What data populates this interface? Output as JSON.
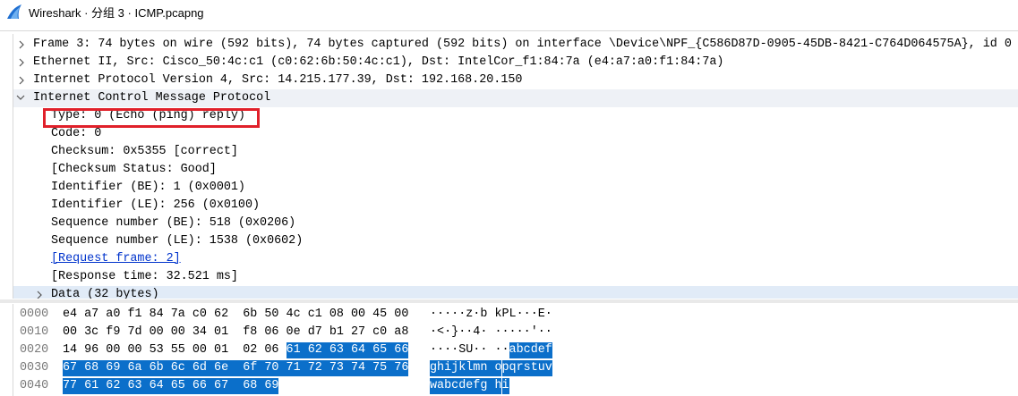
{
  "window": {
    "title": "Wireshark · 分组 3 · ICMP.pcapng"
  },
  "tree": {
    "frame": "Frame 3: 74 bytes on wire (592 bits), 74 bytes captured (592 bits) on interface \\Device\\NPF_{C586D87D-0905-45DB-8421-C764D064575A}, id 0",
    "ethernet": "Ethernet II, Src: Cisco_50:4c:c1 (c0:62:6b:50:4c:c1), Dst: IntelCor_f1:84:7a (e4:a7:a0:f1:84:7a)",
    "ip": "Internet Protocol Version 4, Src: 14.215.177.39, Dst: 192.168.20.150",
    "icmp": "Internet Control Message Protocol",
    "icmp_fields": {
      "type": "Type: 0 (Echo (ping) reply)",
      "code": "Code: 0",
      "checksum": "Checksum: 0x5355 [correct]",
      "checksum_status": "[Checksum Status: Good]",
      "id_be": "Identifier (BE): 1 (0x0001)",
      "id_le": "Identifier (LE): 256 (0x0100)",
      "seq_be": "Sequence number (BE): 518 (0x0206)",
      "seq_le": "Sequence number (LE): 1538 (0x0602)",
      "request_frame": "[Request frame: 2]",
      "response_time": "[Response time: 32.521 ms]",
      "data": "Data (32 bytes)"
    }
  },
  "hex": {
    "rows": [
      {
        "offset": "0000",
        "bytes": [
          "e4",
          "a7",
          "a0",
          "f1",
          "84",
          "7a",
          "c0",
          "62",
          "6b",
          "50",
          "4c",
          "c1",
          "08",
          "00",
          "45",
          "00"
        ],
        "selected_from": 16,
        "ascii": [
          "·",
          "·",
          "·",
          "·",
          "·",
          "z",
          "·",
          "b",
          "k",
          "P",
          "L",
          "·",
          "·",
          "·",
          "E",
          "·"
        ]
      },
      {
        "offset": "0010",
        "bytes": [
          "00",
          "3c",
          "f9",
          "7d",
          "00",
          "00",
          "34",
          "01",
          "f8",
          "06",
          "0e",
          "d7",
          "b1",
          "27",
          "c0",
          "a8"
        ],
        "selected_from": 16,
        "ascii": [
          "·",
          "<",
          "·",
          "}",
          "·",
          "·",
          "4",
          "·",
          "·",
          "·",
          "·",
          "·",
          "·",
          "'",
          "·",
          "·"
        ]
      },
      {
        "offset": "0020",
        "bytes": [
          "14",
          "96",
          "00",
          "00",
          "53",
          "55",
          "00",
          "01",
          "02",
          "06",
          "61",
          "62",
          "63",
          "64",
          "65",
          "66"
        ],
        "selected_from": 10,
        "ascii": [
          "·",
          "·",
          "·",
          "·",
          "S",
          "U",
          "·",
          "·",
          "·",
          "·",
          "a",
          "b",
          "c",
          "d",
          "e",
          "f"
        ]
      },
      {
        "offset": "0030",
        "bytes": [
          "67",
          "68",
          "69",
          "6a",
          "6b",
          "6c",
          "6d",
          "6e",
          "6f",
          "70",
          "71",
          "72",
          "73",
          "74",
          "75",
          "76"
        ],
        "selected_from": 0,
        "ascii": [
          "g",
          "h",
          "i",
          "j",
          "k",
          "l",
          "m",
          "n",
          "o",
          "p",
          "q",
          "r",
          "s",
          "t",
          "u",
          "v"
        ]
      },
      {
        "offset": "0040",
        "bytes": [
          "77",
          "61",
          "62",
          "63",
          "64",
          "65",
          "66",
          "67",
          "68",
          "69"
        ],
        "selected_from": 0,
        "ascii": [
          "w",
          "a",
          "b",
          "c",
          "d",
          "e",
          "f",
          "g",
          "h",
          "i"
        ]
      }
    ]
  },
  "colors": {
    "selection": "#0b6fca",
    "highlight_box": "#e0202a",
    "link": "#0033cc"
  }
}
